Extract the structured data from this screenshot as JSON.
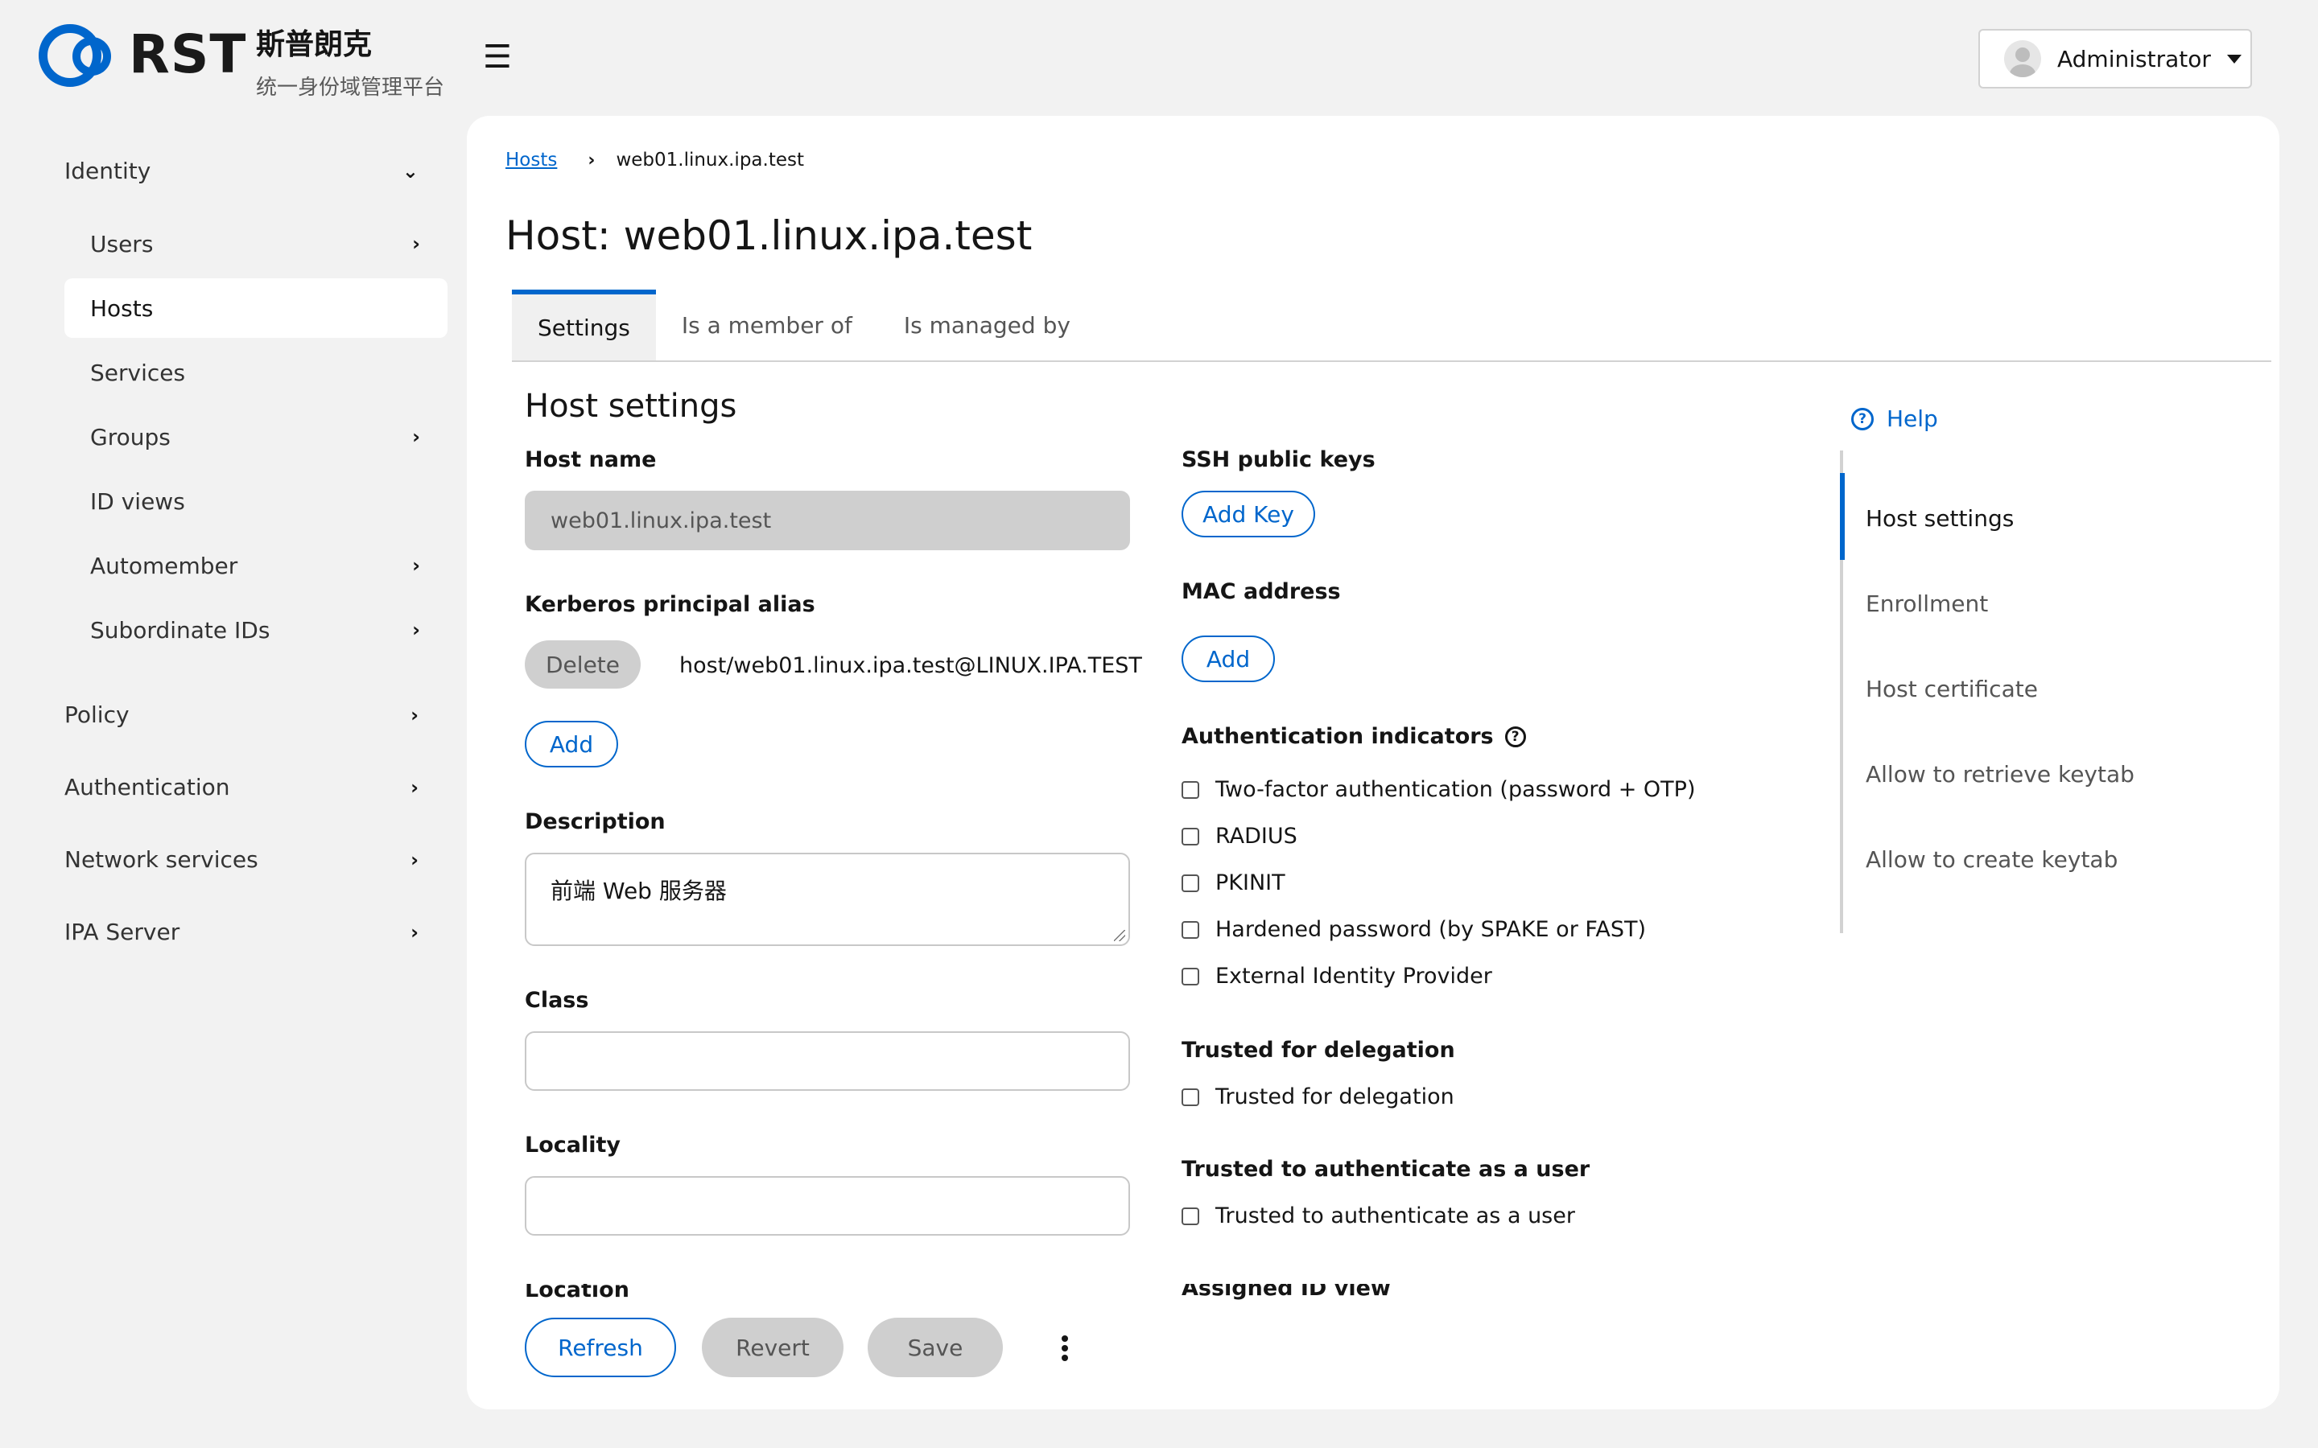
{
  "header": {
    "logo_text": "RST",
    "brand_cn": "斯普朗克",
    "brand_sub": "统一身份域管理平台",
    "menu_icon": "☰",
    "user_name": "Administrator"
  },
  "sidebar": {
    "identity": "Identity",
    "items": [
      "Users",
      "Hosts",
      "Services",
      "Groups",
      "ID views",
      "Automember",
      "Subordinate IDs"
    ],
    "policy": "Policy",
    "authentication": "Authentication",
    "network_services": "Network services",
    "ipa_server": "IPA Server"
  },
  "breadcrumb": {
    "parent": "Hosts",
    "current": "web01.linux.ipa.test"
  },
  "page_title": "Host: web01.linux.ipa.test",
  "tabs": [
    "Settings",
    "Is a member of",
    "Is managed by"
  ],
  "form": {
    "section_title": "Host settings",
    "host_name_label": "Host name",
    "host_name_value": "web01.linux.ipa.test",
    "kerberos_label": "Kerberos principal alias",
    "delete_label": "Delete",
    "principal_value": "host/web01.linux.ipa.test@LINUX.IPA.TEST",
    "add_label": "Add",
    "description_label": "Description",
    "description_value": "前端 Web 服务器",
    "class_label": "Class",
    "locality_label": "Locality",
    "location_label": "Location",
    "ssh_label": "SSH public keys",
    "add_key_label": "Add Key",
    "mac_label": "MAC address",
    "auth_ind_label": "Authentication indicators",
    "auth_options": [
      "Two-factor authentication (password + OTP)",
      "RADIUS",
      "PKINIT",
      "Hardened password (by SPAKE or FAST)",
      "External Identity Provider"
    ],
    "trusted_deleg_label": "Trusted for delegation",
    "trusted_deleg_option": "Trusted for delegation",
    "trusted_auth_label": "Trusted to authenticate as a user",
    "trusted_auth_option": "Trusted to authenticate as a user",
    "assigned_view_label": "Assigned ID view"
  },
  "help": {
    "label": "Help",
    "jump_links": [
      "Host settings",
      "Enrollment",
      "Host certificate",
      "Allow to retrieve keytab",
      "Allow to create keytab"
    ]
  },
  "footer": {
    "refresh": "Refresh",
    "revert": "Revert",
    "save": "Save"
  },
  "colors": {
    "accent": "#0066cc",
    "background": "#f2f2f2",
    "disabled": "#cfcfcf"
  }
}
